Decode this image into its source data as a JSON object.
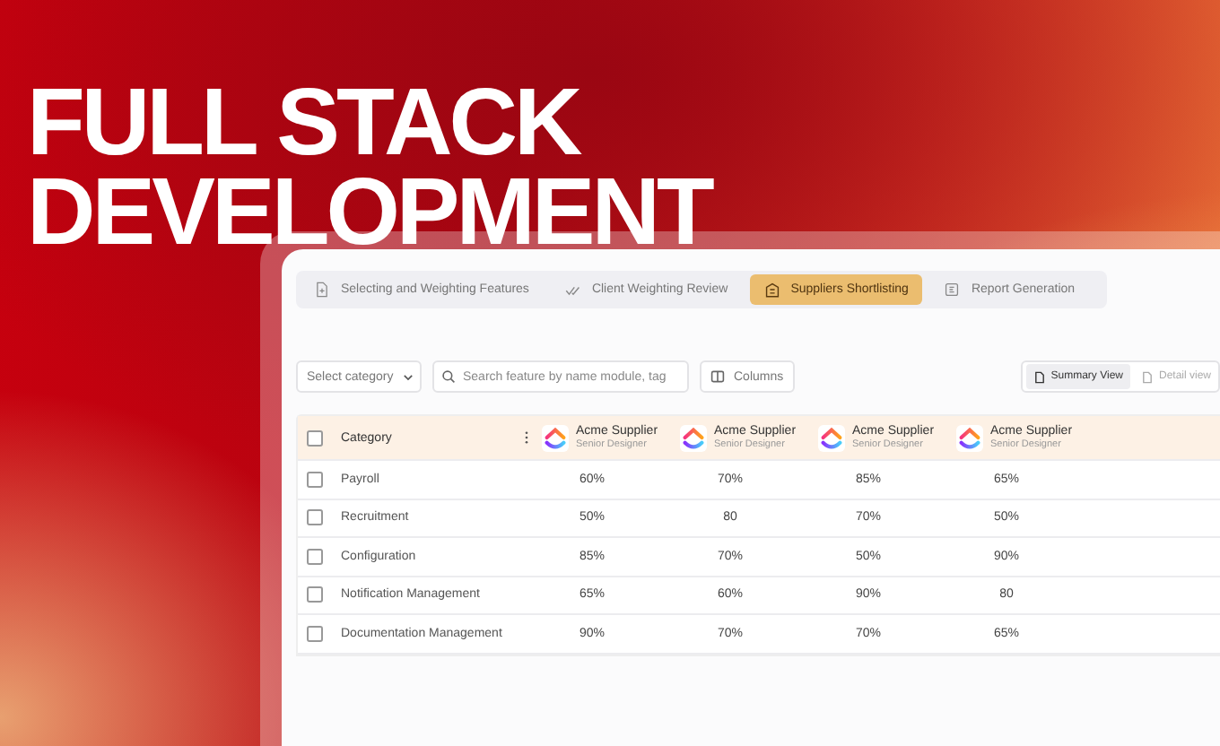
{
  "headline": [
    "FULL STACK",
    "DEVELOPMENT"
  ],
  "tabs": [
    {
      "label": "Selecting and Weighting Features",
      "selected": false
    },
    {
      "label": "Client Weighting Review",
      "selected": false
    },
    {
      "label": "Suppliers Shortlisting",
      "selected": true
    },
    {
      "label": "Report Generation",
      "selected": false
    }
  ],
  "filters": {
    "category": {
      "placeholder": "Select category"
    },
    "search": {
      "placeholder": "Search feature by name module, tag"
    },
    "columns_button": "Columns"
  },
  "views": [
    {
      "label": "Summary View",
      "selected": true
    },
    {
      "label": "Detail view",
      "selected": false
    }
  ],
  "table": {
    "all_checked": false,
    "category_heading": "Category",
    "suppliers": [
      {
        "name": "Acme Supplier",
        "role": "Senior Designer"
      },
      {
        "name": "Acme Supplier",
        "role": "Senior Designer"
      },
      {
        "name": "Acme Supplier",
        "role": "Senior Designer"
      },
      {
        "name": "Acme Supplier",
        "role": "Senior Designer"
      }
    ],
    "rows": [
      {
        "category": "Payroll",
        "checked": false,
        "values": [
          "60%",
          "70%",
          "85%",
          "65%"
        ]
      },
      {
        "category": "Recruitment",
        "checked": false,
        "values": [
          "50%",
          "80",
          "70%",
          "50%"
        ]
      },
      {
        "category": "Configuration",
        "checked": false,
        "values": [
          "85%",
          "70%",
          "50%",
          "90%"
        ]
      },
      {
        "category": "Notification Management",
        "checked": false,
        "values": [
          "65%",
          "60%",
          "90%",
          "80"
        ]
      },
      {
        "category": "Documentation Management",
        "checked": false,
        "values": [
          "90%",
          "70%",
          "70%",
          "65%"
        ]
      }
    ]
  }
}
